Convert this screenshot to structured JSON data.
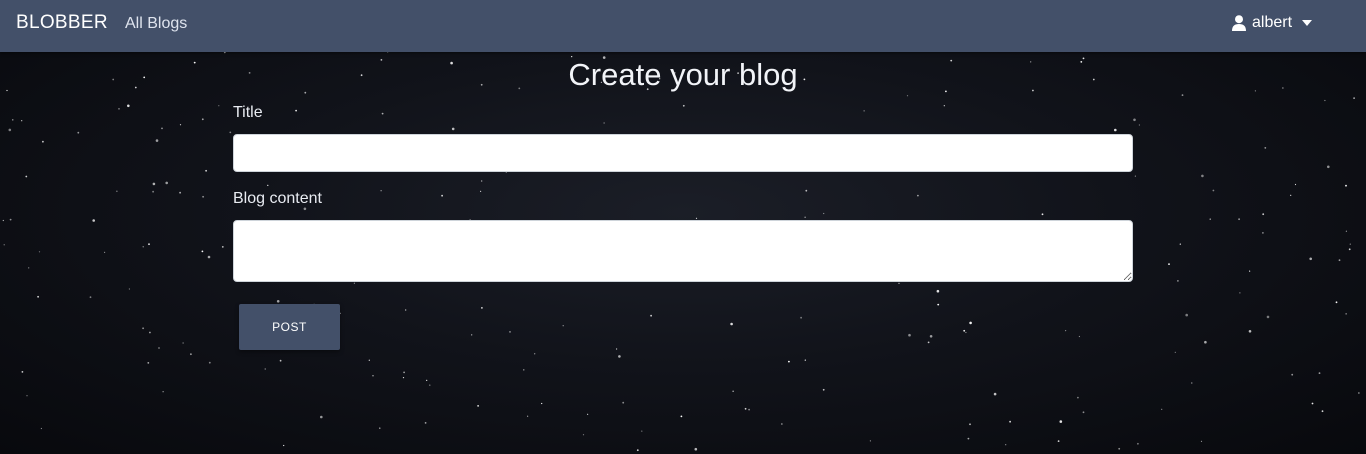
{
  "navbar": {
    "brand": "BLOBBER",
    "links": [
      "All Blogs"
    ],
    "user": {
      "name": "albert",
      "icon": "user-icon"
    },
    "color": "#435069"
  },
  "form": {
    "heading": "Create your blog",
    "title_label": "Title",
    "title_value": "",
    "content_label": "Blog content",
    "content_value": "",
    "submit_label": "POST"
  },
  "theme": {
    "background": "starfield",
    "accent": "#435069"
  }
}
